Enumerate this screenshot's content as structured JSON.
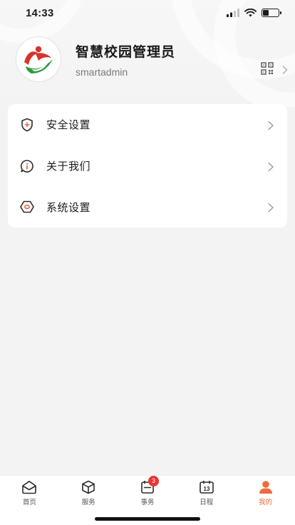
{
  "status_bar": {
    "time": "14:33"
  },
  "profile": {
    "name": "智慧校园管理员",
    "username": "smartadmin"
  },
  "menu": {
    "items": [
      {
        "label": "安全设置",
        "icon": "shield-plus-icon"
      },
      {
        "label": "关于我们",
        "icon": "info-bubble-icon"
      },
      {
        "label": "系统设置",
        "icon": "hexagon-settings-icon"
      }
    ]
  },
  "tab_bar": {
    "tabs": [
      {
        "label": "首页",
        "icon": "home-icon"
      },
      {
        "label": "服务",
        "icon": "cube-icon"
      },
      {
        "label": "事务",
        "icon": "affairs-icon",
        "badge": "3"
      },
      {
        "label": "日程",
        "icon": "calendar-icon",
        "date": "13"
      },
      {
        "label": "我的",
        "icon": "person-icon",
        "active": true
      }
    ]
  },
  "colors": {
    "accent": "#ef6a3a",
    "badge": "#e8352e",
    "background": "#f3f3f4",
    "card": "#ffffff"
  }
}
